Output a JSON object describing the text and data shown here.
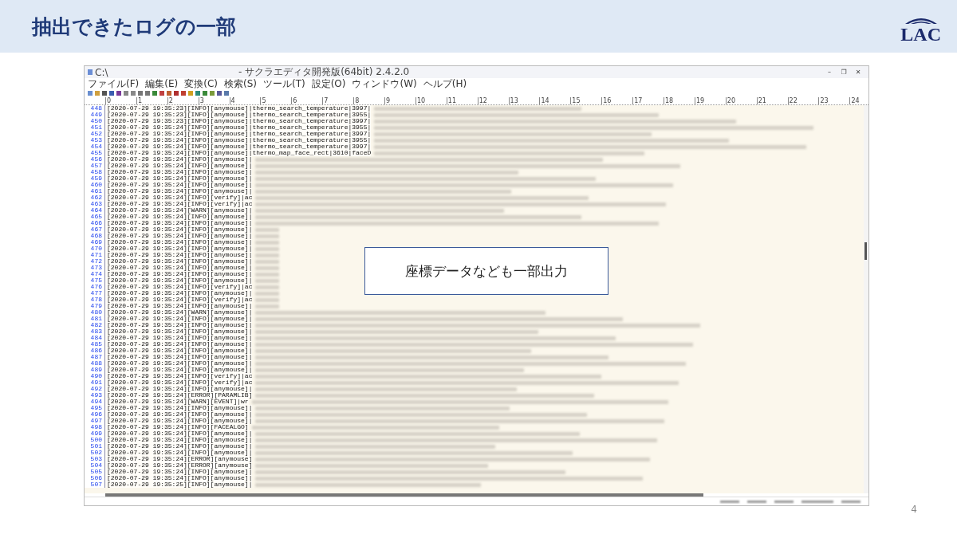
{
  "slide": {
    "title": "抽出できたログの一部",
    "logo": "LAC",
    "page_number": "4"
  },
  "callout": "座標データなども一部出力",
  "window": {
    "path": "C:\\",
    "title": "- サクラエディタ開発版(64bit) 2.4.2.0",
    "controls": [
      "–",
      "❐",
      "✕"
    ]
  },
  "menu": [
    "ファイル(F)",
    "編集(E)",
    "変換(C)",
    "検索(S)",
    "ツール(T)",
    "設定(O)",
    "ウィンドウ(W)",
    "ヘルプ(H)"
  ],
  "ruler": [
    "0",
    "1",
    "2",
    "3",
    "4",
    "5",
    "6",
    "7",
    "8",
    "9",
    "10",
    "11",
    "12",
    "13",
    "14",
    "15",
    "16",
    "17",
    "18",
    "19",
    "20",
    "21",
    "22",
    "23",
    "24"
  ],
  "lines": [
    {
      "number": "448",
      "text": "[2020-07-29 19:35:23][INFO][anymouse]|thermo_search_temperature|3997|"
    },
    {
      "number": "449",
      "text": "[2020-07-29 19:35:23][INFO][anymouse]|thermo_search_temperature|3955|"
    },
    {
      "number": "450",
      "text": "[2020-07-29 19:35:23][INFO][anymouse]|thermo_search_temperature|3997|"
    },
    {
      "number": "451",
      "text": "[2020-07-29 19:35:24][INFO][anymouse]|thermo_search_temperature|3955|"
    },
    {
      "number": "452",
      "text": "[2020-07-29 19:35:24][INFO][anymouse]|thermo_search_temperature|3997|"
    },
    {
      "number": "453",
      "text": "[2020-07-29 19:35:24][INFO][anymouse]|thermo_search_temperature|3955|"
    },
    {
      "number": "454",
      "text": "[2020-07-29 19:35:24][INFO][anymouse]|thermo_search_temperature|3997|"
    },
    {
      "number": "455",
      "text": "[2020-07-29 19:35:24][INFO][anymouse]|thermo_map_face_rect|3610|faceD"
    },
    {
      "number": "456",
      "text": "[2020-07-29 19:35:24][INFO][anymouse]|"
    },
    {
      "number": "457",
      "text": "[2020-07-29 19:35:24][INFO][anymouse]|"
    },
    {
      "number": "458",
      "text": "[2020-07-29 19:35:24][INFO][anymouse]|"
    },
    {
      "number": "459",
      "text": "[2020-07-29 19:35:24][INFO][anymouse]|"
    },
    {
      "number": "460",
      "text": "[2020-07-29 19:35:24][INFO][anymouse]|"
    },
    {
      "number": "461",
      "text": "[2020-07-29 19:35:24][INFO][anymouse]|"
    },
    {
      "number": "462",
      "text": "[2020-07-29 19:35:24][INFO][verify]|ac"
    },
    {
      "number": "463",
      "text": "[2020-07-29 19:35:24][INFO][verify]|ac"
    },
    {
      "number": "464",
      "text": "[2020-07-29 19:35:24][WARN][anymouse]|"
    },
    {
      "number": "465",
      "text": "[2020-07-29 19:35:24][INFO][anymouse]|"
    },
    {
      "number": "466",
      "text": "[2020-07-29 19:35:24][INFO][anymouse]|"
    },
    {
      "number": "467",
      "text": "[2020-07-29 19:35:24][INFO][anymouse]|"
    },
    {
      "number": "468",
      "text": "[2020-07-29 19:35:24][INFO][anymouse]|"
    },
    {
      "number": "469",
      "text": "[2020-07-29 19:35:24][INFO][anymouse]|"
    },
    {
      "number": "470",
      "text": "[2020-07-29 19:35:24][INFO][anymouse]|"
    },
    {
      "number": "471",
      "text": "[2020-07-29 19:35:24][INFO][anymouse]|"
    },
    {
      "number": "472",
      "text": "[2020-07-29 19:35:24][INFO][anymouse]|"
    },
    {
      "number": "473",
      "text": "[2020-07-29 19:35:24][INFO][anymouse]|"
    },
    {
      "number": "474",
      "text": "[2020-07-29 19:35:24][INFO][anymouse]|"
    },
    {
      "number": "475",
      "text": "[2020-07-29 19:35:24][INFO][anymouse]|"
    },
    {
      "number": "476",
      "text": "[2020-07-29 19:35:24][INFO][verify]|ac"
    },
    {
      "number": "477",
      "text": "[2020-07-29 19:35:24][INFO][anymouse]|"
    },
    {
      "number": "478",
      "text": "[2020-07-29 19:35:24][INFO][verify]|ac"
    },
    {
      "number": "479",
      "text": "[2020-07-29 19:35:24][INFO][anymouse]|"
    },
    {
      "number": "480",
      "text": "[2020-07-29 19:35:24][WARN][anymouse]|"
    },
    {
      "number": "481",
      "text": "[2020-07-29 19:35:24][INFO][anymouse]|"
    },
    {
      "number": "482",
      "text": "[2020-07-29 19:35:24][INFO][anymouse]|"
    },
    {
      "number": "483",
      "text": "[2020-07-29 19:35:24][INFO][anymouse]|"
    },
    {
      "number": "484",
      "text": "[2020-07-29 19:35:24][INFO][anymouse]|"
    },
    {
      "number": "485",
      "text": "[2020-07-29 19:35:24][INFO][anymouse]|"
    },
    {
      "number": "486",
      "text": "[2020-07-29 19:35:24][INFO][anymouse]|"
    },
    {
      "number": "487",
      "text": "[2020-07-29 19:35:24][INFO][anymouse]|"
    },
    {
      "number": "488",
      "text": "[2020-07-29 19:35:24][INFO][anymouse]|"
    },
    {
      "number": "489",
      "text": "[2020-07-29 19:35:24][INFO][anymouse]|"
    },
    {
      "number": "490",
      "text": "[2020-07-29 19:35:24][INFO][verify]|ac"
    },
    {
      "number": "491",
      "text": "[2020-07-29 19:35:24][INFO][verify]|ac"
    },
    {
      "number": "492",
      "text": "[2020-07-29 19:35:24][INFO][anymouse]|"
    },
    {
      "number": "493",
      "text": "[2020-07-29 19:35:24][ERROR][PARAMLIB]"
    },
    {
      "number": "494",
      "text": "[2020-07-29 19:35:24][WARN][EVENT]|wr"
    },
    {
      "number": "495",
      "text": "[2020-07-29 19:35:24][INFO][anymouse]|"
    },
    {
      "number": "496",
      "text": "[2020-07-29 19:35:24][INFO][anymouse]|"
    },
    {
      "number": "497",
      "text": "[2020-07-29 19:35:24][INFO][anymouse]|"
    },
    {
      "number": "498",
      "text": "[2020-07-29 19:35:24][INFO][FACEALGO]"
    },
    {
      "number": "499",
      "text": "[2020-07-29 19:35:24][INFO][anymouse]|"
    },
    {
      "number": "500",
      "text": "[2020-07-29 19:35:24][INFO][anymouse]|"
    },
    {
      "number": "501",
      "text": "[2020-07-29 19:35:24][INFO][anymouse]|"
    },
    {
      "number": "502",
      "text": "[2020-07-29 19:35:24][INFO][anymouse]|"
    },
    {
      "number": "503",
      "text": "[2020-07-29 19:35:24][ERROR][anymouse]"
    },
    {
      "number": "504",
      "text": "[2020-07-29 19:35:24][ERROR][anymouse]"
    },
    {
      "number": "505",
      "text": "[2020-07-29 19:35:24][INFO][anymouse]|"
    },
    {
      "number": "506",
      "text": "[2020-07-29 19:35:24][INFO][anymouse]|"
    },
    {
      "number": "507",
      "text": "[2020-07-29 19:35:25][INFO][anymouse]|"
    }
  ]
}
